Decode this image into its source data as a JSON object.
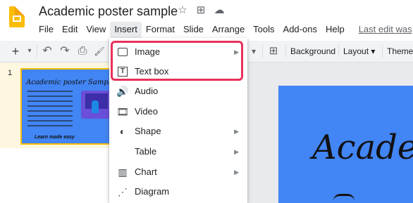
{
  "doc_title": "Academic poster sample",
  "title_icons": [
    "star-icon",
    "move-to-folder-icon",
    "cloud-saved-icon"
  ],
  "menubar": {
    "items": [
      "File",
      "Edit",
      "View",
      "Insert",
      "Format",
      "Slide",
      "Arrange",
      "Tools",
      "Add-ons",
      "Help"
    ],
    "active": "Insert",
    "last_edit": "Last edit was"
  },
  "toolbar": {
    "new_slide": "+",
    "new_slide_dropdown": "▾",
    "undo": "↶",
    "redo": "↷",
    "print": "⎙",
    "paint_format": "🖌",
    "background_label": "Background",
    "layout_label": "Layout",
    "theme_label": "Theme"
  },
  "filmstrip": {
    "slide_number": "1",
    "thumb_title": "Academic poster Sample",
    "thumb_footer": "Learn made easy"
  },
  "canvas": {
    "title": "Academ"
  },
  "insert_menu": {
    "items": [
      {
        "label": "Image",
        "icon": "image-icon",
        "submenu": true
      },
      {
        "label": "Text box",
        "icon": "text-box-icon",
        "submenu": false
      },
      {
        "label": "Audio",
        "icon": "audio-icon",
        "submenu": false
      },
      {
        "label": "Video",
        "icon": "video-icon",
        "submenu": false
      },
      {
        "label": "Shape",
        "icon": "shape-icon",
        "submenu": true
      },
      {
        "label": "Table",
        "icon": "",
        "submenu": true
      },
      {
        "label": "Chart",
        "icon": "chart-icon",
        "submenu": true
      },
      {
        "label": "Diagram",
        "icon": "diagram-icon",
        "submenu": false
      }
    ],
    "submenu_arrow": "▶"
  },
  "colors": {
    "highlight": "#e8325a",
    "slide_background": "#4285f4",
    "selection": "#fbbc04"
  }
}
